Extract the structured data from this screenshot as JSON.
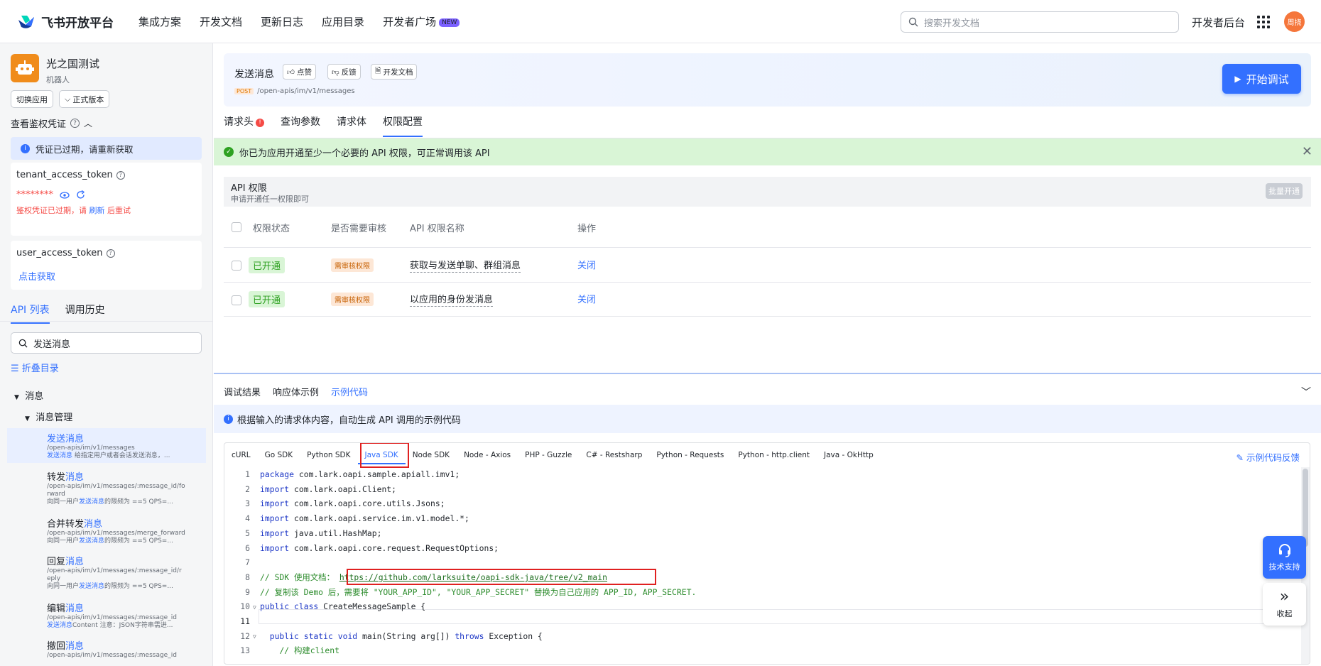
{
  "brand": {
    "name": "飞书开放平台"
  },
  "nav": [
    {
      "label": "集成方案"
    },
    {
      "label": "开发文档"
    },
    {
      "label": "更新日志"
    },
    {
      "label": "应用目录"
    },
    {
      "label": "开发者广场",
      "badge": "NEW"
    }
  ],
  "search": {
    "placeholder": "搜索开发文档"
  },
  "topright": {
    "console": "开发者后台",
    "avatar": "周挠"
  },
  "sidebar": {
    "app_name": "光之国测试",
    "app_role": "机器人",
    "switch_app": "切换应用",
    "version": "正式版本",
    "credential_toggle": "查看鉴权凭证",
    "expired_notice": "凭证已过期，请重新获取",
    "tenant_token_label": "tenant_access_token",
    "tenant_token_mask": "********",
    "tenant_error_prefix": "鉴权凭证已过期，请",
    "tenant_error_link": "刷新",
    "tenant_error_suffix": "后重试",
    "user_token_label": "user_access_token",
    "user_token_action": "点击获取",
    "tabs": [
      "API 列表",
      "调用历史"
    ],
    "search_value": "发送消息",
    "fold_label": "折叠目录",
    "tree_root": "消息",
    "tree_group": "消息管理",
    "api_items": [
      {
        "name_pre": "发送",
        "name_hl": "消息",
        "path1": "/open-apis/im/v1/messages",
        "path2": "",
        "desc_pre": "",
        "desc_hl": "发送消息",
        "desc_post": " 给指定用户或者会话发送消息，..."
      },
      {
        "name_pre": "转发",
        "name_hl": "消息",
        "path1": "/open-apis/im/v1/messages/:message_id/fo",
        "path2": "rward",
        "desc_pre": "向同一用户",
        "desc_hl": "发送消息",
        "desc_post": "的限频为 ==5 QPS=..."
      },
      {
        "name_pre": "合并转发",
        "name_hl": "消息",
        "path1": "/open-apis/im/v1/messages/merge_forward",
        "path2": "",
        "desc_pre": "向同一用户",
        "desc_hl": "发送消息",
        "desc_post": "的限频为 ==5 QPS=..."
      },
      {
        "name_pre": "回复",
        "name_hl": "消息",
        "path1": "/open-apis/im/v1/messages/:message_id/r",
        "path2": "eply",
        "desc_pre": "向同一用户",
        "desc_hl": "发送消息",
        "desc_post": "的限频为 ==5 QPS=..."
      },
      {
        "name_pre": "编辑",
        "name_hl": "消息",
        "path1": "/open-apis/im/v1/messages/:message_id",
        "path2": "",
        "desc_pre": "",
        "desc_hl": "发送消息",
        "desc_post": "Content 注意：JSON字符串需进..."
      },
      {
        "name_pre": "撤回",
        "name_hl": "消息",
        "path1": "/open-apis/im/v1/messages/:message_id",
        "path2": "",
        "desc_pre": "",
        "desc_hl": "",
        "desc_post": ""
      }
    ]
  },
  "api_header": {
    "title": "发送消息",
    "like": "点赞",
    "feedback": "反馈",
    "docs": "开发文档",
    "method": "POST",
    "path": "/open-apis/im/v1/messages",
    "start": "开始调试"
  },
  "main_tabs": [
    {
      "label": "请求头",
      "alert": "!"
    },
    {
      "label": "查询参数"
    },
    {
      "label": "请求体"
    },
    {
      "label": "权限配置"
    }
  ],
  "success_msg": "你已为应用开通至少一个必要的 API 权限，可正常调用该 API",
  "permissions": {
    "title": "API 权限",
    "subtitle": "申请开通任一权限即可",
    "batch": "批量开通",
    "headers": [
      "权限状态",
      "是否需要审核",
      "API 权限名称",
      "操作"
    ],
    "rows": [
      {
        "status": "已开通",
        "review": "需审核权限",
        "name": "获取与发送单聊、群组消息",
        "action": "关闭"
      },
      {
        "status": "已开通",
        "review": "需审核权限",
        "name": "以应用的身份发消息",
        "action": "关闭"
      }
    ]
  },
  "bottom_tabs": [
    "调试结果",
    "响应体示例",
    "示例代码"
  ],
  "info_msg": "根据输入的请求体内容，自动生成 API 调用的示例代码",
  "lang_tabs": [
    "cURL",
    "Go SDK",
    "Python SDK",
    "Java SDK",
    "Node SDK",
    "Node - Axios",
    "PHP - Guzzle",
    "C# - Restsharp",
    "Python - Requests",
    "Python - http.client",
    "Java - OkHttp"
  ],
  "code_feedback": "示例代码反馈",
  "code": {
    "l1_kw": "package",
    "l1_rest": " com.lark.oapi.sample.apiall.imv1;",
    "l2_kw": "import",
    "l2_rest": " com.lark.oapi.Client;",
    "l3_kw": "import",
    "l3_rest": " com.lark.oapi.core.utils.Jsons;",
    "l4_kw": "import",
    "l4_rest": " com.lark.oapi.service.im.v1.model.*;",
    "l5_kw": "import",
    "l5_rest": " java.util.HashMap;",
    "l6_kw": "import",
    "l6_rest": " com.lark.oapi.core.request.RequestOptions;",
    "l8_comment": "// SDK 使用文档：",
    "l8_link": "https://github.com/larksuite/oapi-sdk-java/tree/v2_main",
    "l9_pre": "// 复制该 Demo 后，需要将 ",
    "l9_s1": "\"YOUR_APP_ID\"",
    "l9_mid": ", ",
    "l9_s2": "\"YOUR_APP_SECRET\"",
    "l9_post": " 替换为自己应用的 APP_ID, APP_SECRET.",
    "l10_kw": "public class",
    "l10_rest": " CreateMessageSample {",
    "l12_kw1": "public static void",
    "l12_mid": " main(String arg[]) ",
    "l12_kw2": "throws",
    "l12_rest": " Exception {",
    "l13_comment": "// 构建client"
  },
  "floating": {
    "support": "技术支持",
    "collapse": "收起"
  }
}
